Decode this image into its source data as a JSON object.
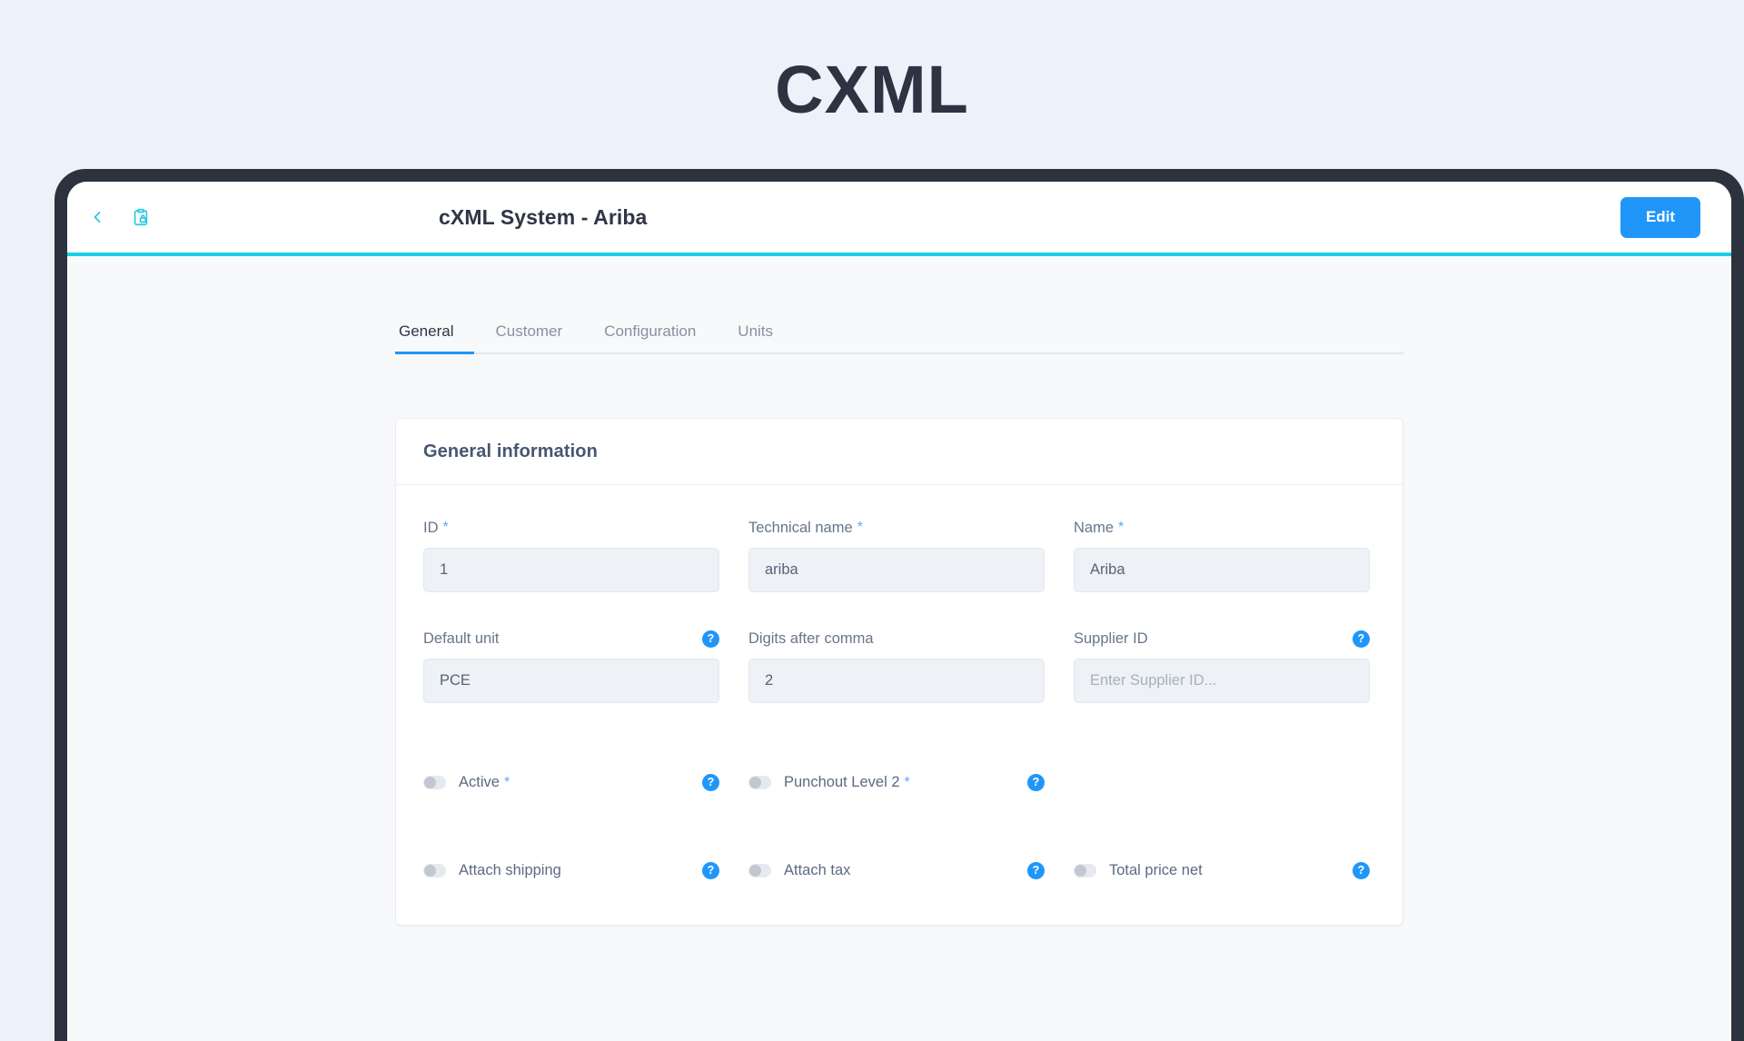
{
  "page": {
    "title": "CXML"
  },
  "header": {
    "back_icon": "chevron-left-icon",
    "app_icon": "clipboard-lock-icon",
    "title": "cXML System - Ariba",
    "edit_label": "Edit",
    "accent_color": "#17cfe5",
    "primary_color": "#2196f9"
  },
  "tabs": [
    {
      "label": "General",
      "active": true
    },
    {
      "label": "Customer",
      "active": false
    },
    {
      "label": "Configuration",
      "active": false
    },
    {
      "label": "Units",
      "active": false
    }
  ],
  "card": {
    "title": "General information",
    "fields_row1": [
      {
        "label": "ID",
        "required": true,
        "value": "1",
        "placeholder": "",
        "help": false
      },
      {
        "label": "Technical name",
        "required": true,
        "value": "ariba",
        "placeholder": "",
        "help": false
      },
      {
        "label": "Name",
        "required": true,
        "value": "Ariba",
        "placeholder": "",
        "help": false
      }
    ],
    "fields_row2": [
      {
        "label": "Default unit",
        "required": false,
        "value": "PCE",
        "placeholder": "",
        "help": true
      },
      {
        "label": "Digits after comma",
        "required": false,
        "value": "2",
        "placeholder": "",
        "help": false
      },
      {
        "label": "Supplier ID",
        "required": false,
        "value": "",
        "placeholder": "Enter Supplier ID...",
        "help": true
      }
    ],
    "toggles_row1": [
      {
        "label": "Active",
        "required": true,
        "on": false,
        "help": true
      },
      {
        "label": "Punchout Level 2",
        "required": true,
        "on": false,
        "help": true
      }
    ],
    "toggles_row2": [
      {
        "label": "Attach shipping",
        "required": false,
        "on": false,
        "help": true
      },
      {
        "label": "Attach tax",
        "required": false,
        "on": false,
        "help": true
      },
      {
        "label": "Total price net",
        "required": false,
        "on": false,
        "help": true
      }
    ],
    "help_glyph": "?"
  }
}
